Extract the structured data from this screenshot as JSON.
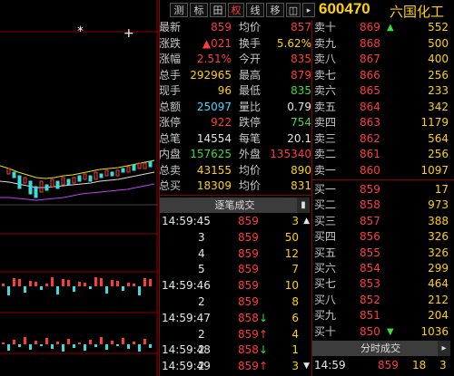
{
  "toolbar": {
    "buttons": [
      "测",
      "标",
      "田",
      "权",
      "线",
      "移"
    ],
    "code": "600470",
    "name": "六国化工"
  },
  "chart_marks": {
    "star1": "*",
    "star2": "+"
  },
  "quote_left": [
    {
      "label": "最新",
      "value": "859"
    },
    {
      "label": "涨跌",
      "value": "▲021"
    },
    {
      "label": "涨幅",
      "value": "2.51%"
    },
    {
      "label": "总手",
      "value": "292965"
    },
    {
      "label": "现手",
      "value": "96"
    },
    {
      "label": "总额",
      "value": "25097"
    },
    {
      "label": "涨停",
      "value": "922"
    },
    {
      "label": "总笔",
      "value": "14554"
    },
    {
      "label": "内盘",
      "value": "157625"
    },
    {
      "label": "总卖",
      "value": "43155"
    },
    {
      "label": "总买",
      "value": "18309"
    }
  ],
  "quote_mid": [
    {
      "label": "均价",
      "value": "857"
    },
    {
      "label": "换手",
      "value": "5.62%"
    },
    {
      "label": "今开",
      "value": "835"
    },
    {
      "label": "最高",
      "value": "879"
    },
    {
      "label": "最低",
      "value": "835"
    },
    {
      "label": "量比",
      "value": "0.79"
    },
    {
      "label": "跌停",
      "value": "754"
    },
    {
      "label": "每笔",
      "value": "20.1"
    },
    {
      "label": "外盘",
      "value": "135340"
    },
    {
      "label": "均价",
      "value": "890"
    },
    {
      "label": "均价",
      "value": "831"
    }
  ],
  "sell_book": [
    {
      "label": "卖十",
      "price": "869",
      "arrow": "▲",
      "vol": "552"
    },
    {
      "label": "卖九",
      "price": "868",
      "arrow": "",
      "vol": "500"
    },
    {
      "label": "卖八",
      "price": "867",
      "arrow": "",
      "vol": "400"
    },
    {
      "label": "卖七",
      "price": "866",
      "arrow": "",
      "vol": "256"
    },
    {
      "label": "卖六",
      "price": "865",
      "arrow": "",
      "vol": "233"
    },
    {
      "label": "卖五",
      "price": "864",
      "arrow": "",
      "vol": "342"
    },
    {
      "label": "卖四",
      "price": "863",
      "arrow": "",
      "vol": "1179"
    },
    {
      "label": "卖三",
      "price": "862",
      "arrow": "",
      "vol": "564"
    },
    {
      "label": "卖二",
      "price": "861",
      "arrow": "",
      "vol": "256"
    },
    {
      "label": "卖一",
      "price": "860",
      "arrow": "",
      "vol": "1097"
    }
  ],
  "buy_book": [
    {
      "label": "买一",
      "price": "859",
      "vol": "17"
    },
    {
      "label": "买二",
      "price": "858",
      "vol": "973"
    },
    {
      "label": "买三",
      "price": "857",
      "vol": "388"
    },
    {
      "label": "买四",
      "price": "856",
      "vol": "326"
    },
    {
      "label": "买五",
      "price": "855",
      "vol": "326"
    },
    {
      "label": "买六",
      "price": "854",
      "vol": "299"
    },
    {
      "label": "买七",
      "price": "853",
      "vol": "464"
    },
    {
      "label": "买八",
      "price": "852",
      "vol": "212"
    },
    {
      "label": "买九",
      "price": "851",
      "vol": "204"
    },
    {
      "label": "买十",
      "price": "850",
      "arrow": "▼",
      "vol": "1036"
    }
  ],
  "ticks_header": "逐笔成交",
  "ticks": [
    {
      "time": "14:59:45",
      "price": "859",
      "arrow": "",
      "vol": "3",
      "flag": "▲"
    },
    {
      "time": "",
      "price": "859",
      "arrow": "",
      "vol": "50",
      "flag": ""
    },
    {
      "time": "",
      "price": "859",
      "arrow": "",
      "vol": "12",
      "flag": ""
    },
    {
      "time": "",
      "price": "859",
      "arrow": "",
      "vol": "7",
      "flag": ""
    },
    {
      "time": "14:59:46",
      "price": "859",
      "arrow": "",
      "vol": "10",
      "flag": ""
    },
    {
      "time": "",
      "price": "859",
      "arrow": "",
      "vol": "8",
      "flag": ""
    },
    {
      "time": "14:59:47",
      "price": "858",
      "arrow": "↓",
      "vol": "6",
      "flag": ""
    },
    {
      "time": "",
      "price": "859",
      "arrow": "↑",
      "vol": "4",
      "flag": ""
    },
    {
      "time": "14:59:48",
      "price": "858",
      "arrow": "↓",
      "vol": "1",
      "flag": ""
    },
    {
      "time": "14:59:49",
      "price": "859",
      "arrow": "↑",
      "vol": "3",
      "flag": "▼"
    }
  ],
  "ticks_values": {
    "r0_vol": "3",
    "r1_vol": "3",
    "r2_vol": "4",
    "r3_vol": "5",
    "r4_vol": "",
    "r5_vol": "2",
    "r6_vol": "2",
    "r7_vol": "2",
    "r8_vol": "2",
    "r9_vol": "2"
  },
  "left_col_vals": [
    "3",
    "4",
    "5",
    "2",
    "2",
    "2",
    "2"
  ],
  "minute_header": "分时成交",
  "minute_row": {
    "time": "14:59",
    "price": "859",
    "vol": "18",
    "flag": "3"
  }
}
